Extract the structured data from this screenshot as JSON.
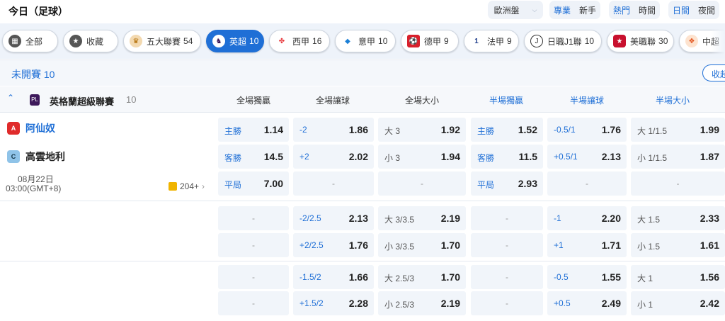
{
  "header": {
    "title": "今日（足球）",
    "odds_format": "歐洲盤",
    "mode_toggle": [
      "專業",
      "新手"
    ],
    "sort_toggle": [
      "熱門",
      "時間"
    ],
    "view_toggle": [
      "日間",
      "夜間"
    ]
  },
  "tabs": [
    {
      "label": "全部",
      "count": "",
      "icon": "grid-icon"
    },
    {
      "label": "收藏",
      "count": "",
      "icon": "star-icon"
    },
    {
      "label": "五大聯賽",
      "count": "54",
      "icon": "trophy-icon"
    },
    {
      "label": "英超",
      "count": "10",
      "icon": "premier-league-icon",
      "active": true
    },
    {
      "label": "西甲",
      "count": "16",
      "icon": "laliga-icon"
    },
    {
      "label": "意甲",
      "count": "10",
      "icon": "serie-a-icon"
    },
    {
      "label": "德甲",
      "count": "9",
      "icon": "bundesliga-icon"
    },
    {
      "label": "法甲",
      "count": "9",
      "icon": "ligue1-icon"
    },
    {
      "label": "日職J1聯",
      "count": "10",
      "icon": "j1-league-icon"
    },
    {
      "label": "美職聯",
      "count": "30",
      "icon": "mls-icon"
    },
    {
      "label": "中超",
      "count": "",
      "icon": "csl-icon"
    }
  ],
  "section": {
    "title": "未開賽",
    "count": "10",
    "collapse_label": "收起"
  },
  "league": {
    "name": "英格蘭超級聯賽",
    "count": "10",
    "headers_full": [
      "全場獨贏",
      "全場讓球",
      "全場大小"
    ],
    "headers_half": [
      "半場獨贏",
      "半場讓球",
      "半場大小"
    ]
  },
  "match": {
    "home": "阿仙奴",
    "away": "高雲地利",
    "date": "08月22日",
    "time": "03:00(GMT+8)",
    "more": "204+"
  },
  "blocks": [
    {
      "rows": [
        [
          [
            "主勝",
            "1.14"
          ],
          [
            "-2",
            "1.86"
          ],
          [
            "大 3",
            "1.92"
          ],
          [
            "主勝",
            "1.52"
          ],
          [
            "-0.5/1",
            "1.76"
          ],
          [
            "大 1/1.5",
            "1.99"
          ]
        ],
        [
          [
            "客勝",
            "14.5"
          ],
          [
            "+2",
            "2.02"
          ],
          [
            "小 3",
            "1.94"
          ],
          [
            "客勝",
            "11.5"
          ],
          [
            "+0.5/1",
            "2.13"
          ],
          [
            "小 1/1.5",
            "1.87"
          ]
        ],
        [
          [
            "平局",
            "7.00"
          ],
          null,
          null,
          [
            "平局",
            "2.93"
          ],
          null,
          null
        ]
      ]
    },
    {
      "rows": [
        [
          null,
          [
            "-2/2.5",
            "2.13"
          ],
          [
            "大 3/3.5",
            "2.19"
          ],
          null,
          [
            "-1",
            "2.20"
          ],
          [
            "大 1.5",
            "2.33"
          ]
        ],
        [
          null,
          [
            "+2/2.5",
            "1.76"
          ],
          [
            "小 3/3.5",
            "1.70"
          ],
          null,
          [
            "+1",
            "1.71"
          ],
          [
            "小 1.5",
            "1.61"
          ]
        ]
      ]
    },
    {
      "rows": [
        [
          null,
          [
            "-1.5/2",
            "1.66"
          ],
          [
            "大 2.5/3",
            "1.70"
          ],
          null,
          [
            "-0.5",
            "1.55"
          ],
          [
            "大 1",
            "1.56"
          ]
        ],
        [
          null,
          [
            "+1.5/2",
            "2.28"
          ],
          [
            "小 2.5/3",
            "2.19"
          ],
          null,
          [
            "+0.5",
            "2.49"
          ],
          [
            "小 1",
            "2.42"
          ]
        ]
      ]
    }
  ],
  "empty_cell": "-",
  "colors": {
    "accent": "#1f6fd6",
    "cell_bg": "#f1f5fa",
    "tabs_bg": "#eef3fa"
  }
}
